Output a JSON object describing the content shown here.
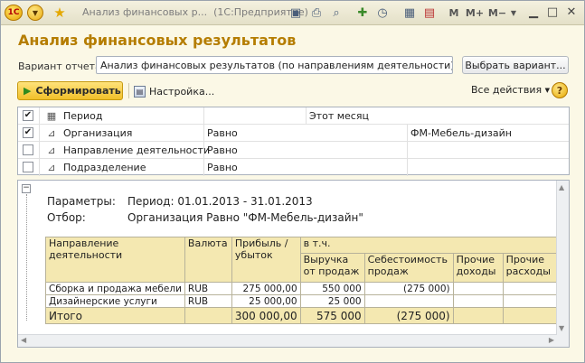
{
  "window": {
    "title": "Анализ финансовых р...",
    "app_name": "(1С:Предприятие)",
    "logo_text": "1С",
    "toolbar_m": "M",
    "toolbar_mplus": "M+",
    "toolbar_mminus": "M−"
  },
  "header": {
    "title": "Анализ финансовых результатов",
    "variant_label": "Вариант отчета:",
    "variant_value": "Анализ финансовых результатов (по направлениям деятельности)",
    "select_variant_label": "Выбрать вариант..."
  },
  "toolbar": {
    "generate_label": "Сформировать",
    "settings_label": "Настройка...",
    "all_actions_label": "Все действия",
    "help_label": "?"
  },
  "settings_rows": [
    {
      "checked": true,
      "field": "Период",
      "comparison": "",
      "value": "Этот месяц"
    },
    {
      "checked": true,
      "field": "Организация",
      "comparison": "Равно",
      "value": "ФМ-Мебель-дизайн"
    },
    {
      "checked": false,
      "field": "Направление деятельности",
      "comparison": "Равно",
      "value": ""
    },
    {
      "checked": false,
      "field": "Подразделение",
      "comparison": "Равно",
      "value": ""
    }
  ],
  "report": {
    "params_label": "Параметры:",
    "params_value": "Период: 01.01.2013 - 31.01.2013",
    "filter_label": "Отбор:",
    "filter_value": "Организация Равно \"ФМ-Мебель-дизайн\"",
    "columns": {
      "direction": "Направление деятельности",
      "currency": "Валюта",
      "profit": "Прибыль / убыток",
      "including": "в т.ч.",
      "revenue": "Выручка от продаж",
      "cost": "Себестоимость продаж",
      "other_income": "Прочие доходы",
      "other_expenses": "Прочие расходы"
    },
    "rows": [
      {
        "direction": "Сборка и продажа мебели",
        "currency": "RUB",
        "profit": "275 000,00",
        "revenue": "550 000",
        "cost": "(275 000)",
        "other_income": "",
        "other_expenses": ""
      },
      {
        "direction": "Дизайнерские услуги",
        "currency": "RUB",
        "profit": "25 000,00",
        "revenue": "25 000",
        "cost": "",
        "other_income": "",
        "other_expenses": ""
      }
    ],
    "total": {
      "label": "Итого",
      "currency": "",
      "profit": "300 000,00",
      "revenue": "575 000",
      "cost": "(275 000)",
      "other_income": "",
      "other_expenses": ""
    }
  }
}
